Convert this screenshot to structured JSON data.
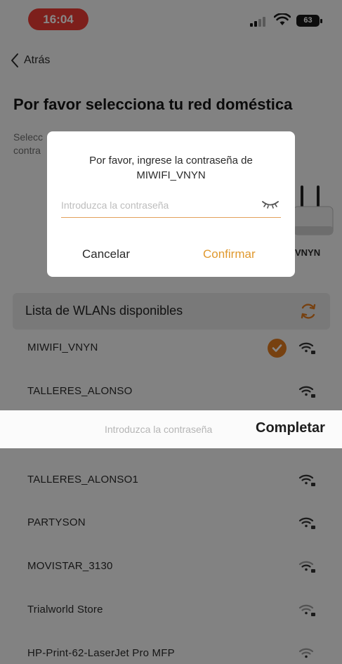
{
  "status_bar": {
    "time": "16:04",
    "battery": "63"
  },
  "header": {
    "back_label": "Atrás",
    "title": "Por favor selecciona tu red doméstica",
    "subtitle_line1": "Selecc",
    "subtitle_line2": "contra"
  },
  "router": {
    "label": "VNYN"
  },
  "wlan": {
    "header": "Lista de WLANs disponibles",
    "networks": [
      {
        "ssid": "MIWIFI_VNYN",
        "selected": true
      },
      {
        "ssid": "TALLERES_ALONSO",
        "selected": false
      },
      {
        "ssid": "TALLERES_ALONSO1",
        "selected": false
      },
      {
        "ssid": "PARTYSON",
        "selected": false
      },
      {
        "ssid": "MOVISTAR_3130",
        "selected": false
      },
      {
        "ssid": "Trialworld Store",
        "selected": false
      },
      {
        "ssid": "HP-Print-62-LaserJet Pro MFP",
        "selected": false
      }
    ]
  },
  "keyboard_bar": {
    "placeholder": "Introduzca la contraseña",
    "done_label": "Completar"
  },
  "dialog": {
    "message": "Por favor, ingrese la contraseña de MIWIFI_VNYN",
    "password_placeholder": "Introduzca la contraseña",
    "password_value": "",
    "cancel_label": "Cancelar",
    "confirm_label": "Confirmar"
  },
  "colors": {
    "accent": "#e07b1f",
    "confirm": "#e0992f",
    "time_pill": "#ec3b33"
  }
}
